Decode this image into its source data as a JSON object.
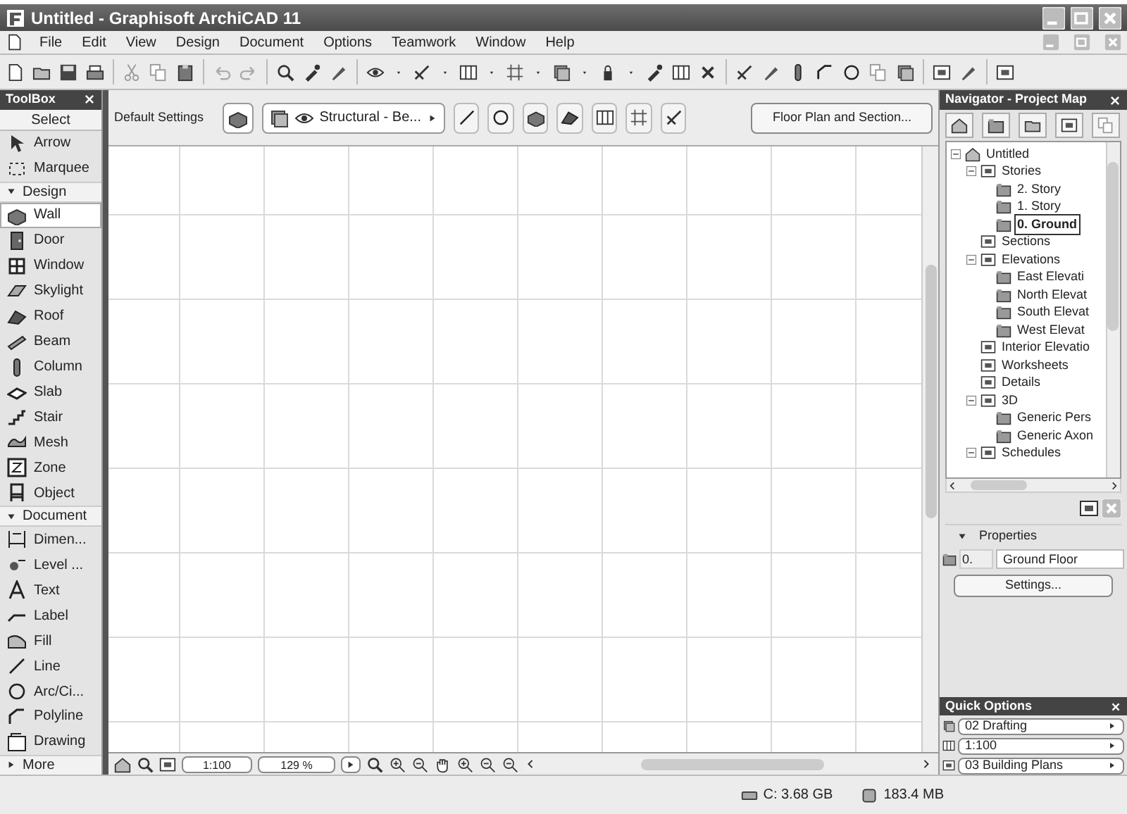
{
  "window": {
    "title": "Untitled - Graphisoft ArchiCAD 11"
  },
  "menu": [
    "File",
    "Edit",
    "View",
    "Design",
    "Document",
    "Options",
    "Teamwork",
    "Window",
    "Help"
  ],
  "toolbox": {
    "title": "ToolBox",
    "select_label": "Select",
    "select_items": [
      {
        "label": "Arrow",
        "selected": false
      },
      {
        "label": "Marquee",
        "selected": false
      }
    ],
    "sections": [
      {
        "title": "Design",
        "expanded": true,
        "items": [
          {
            "label": "Wall",
            "selected": true
          },
          {
            "label": "Door",
            "selected": false
          },
          {
            "label": "Window",
            "selected": false
          },
          {
            "label": "Skylight",
            "selected": false
          },
          {
            "label": "Roof",
            "selected": false
          },
          {
            "label": "Beam",
            "selected": false
          },
          {
            "label": "Column",
            "selected": false
          },
          {
            "label": "Slab",
            "selected": false
          },
          {
            "label": "Stair",
            "selected": false
          },
          {
            "label": "Mesh",
            "selected": false
          },
          {
            "label": "Zone",
            "selected": false
          },
          {
            "label": "Object",
            "selected": false
          }
        ]
      },
      {
        "title": "Document",
        "expanded": true,
        "items": [
          {
            "label": "Dimen...",
            "selected": false
          },
          {
            "label": "Level ...",
            "selected": false
          },
          {
            "label": "Text",
            "selected": false
          },
          {
            "label": "Label",
            "selected": false
          },
          {
            "label": "Fill",
            "selected": false
          },
          {
            "label": "Line",
            "selected": false
          },
          {
            "label": "Arc/Ci...",
            "selected": false
          },
          {
            "label": "Polyline",
            "selected": false
          },
          {
            "label": "Drawing",
            "selected": false
          }
        ]
      }
    ],
    "more": {
      "label": "More",
      "expanded": false
    }
  },
  "info_box": {
    "title": "Default Settings",
    "layer": "Structural - Be...",
    "view_button": "Floor Plan and Section..."
  },
  "canvas_bar": {
    "scale": "1:100",
    "zoom": "129 %"
  },
  "navigator": {
    "title": "Navigator - Project Map",
    "tree": [
      {
        "label": "Untitled",
        "expanded": true,
        "selected": false,
        "children": [
          {
            "label": "Stories",
            "expanded": true,
            "selected": false,
            "children": [
              {
                "label": "2. Story",
                "selected": false
              },
              {
                "label": "1. Story",
                "selected": false
              },
              {
                "label": "0. Ground",
                "selected": true
              }
            ]
          },
          {
            "label": "Sections",
            "selected": false
          },
          {
            "label": "Elevations",
            "expanded": true,
            "selected": false,
            "children": [
              {
                "label": "East Elevati",
                "selected": false
              },
              {
                "label": "North Elevat",
                "selected": false
              },
              {
                "label": "South Elevat",
                "selected": false
              },
              {
                "label": "West Elevat",
                "selected": false
              }
            ]
          },
          {
            "label": "Interior Elevatio",
            "selected": false
          },
          {
            "label": "Worksheets",
            "selected": false
          },
          {
            "label": "Details",
            "selected": false
          },
          {
            "label": "3D",
            "expanded": true,
            "selected": false,
            "children": [
              {
                "label": "Generic Pers",
                "selected": false
              },
              {
                "label": "Generic Axon",
                "selected": false
              }
            ]
          },
          {
            "label": "Schedules",
            "expanded": true,
            "selected": false
          }
        ]
      }
    ]
  },
  "properties": {
    "title": "Properties",
    "expanded": true,
    "story_number": "0.",
    "story_name": "Ground Floor",
    "settings_button": "Settings..."
  },
  "quick_options": {
    "title": "Quick Options",
    "rows": [
      "02 Drafting",
      "1:100",
      "03 Building Plans"
    ]
  },
  "status_bar": {
    "disk": "C: 3.68 GB",
    "memory": "183.4 MB"
  }
}
